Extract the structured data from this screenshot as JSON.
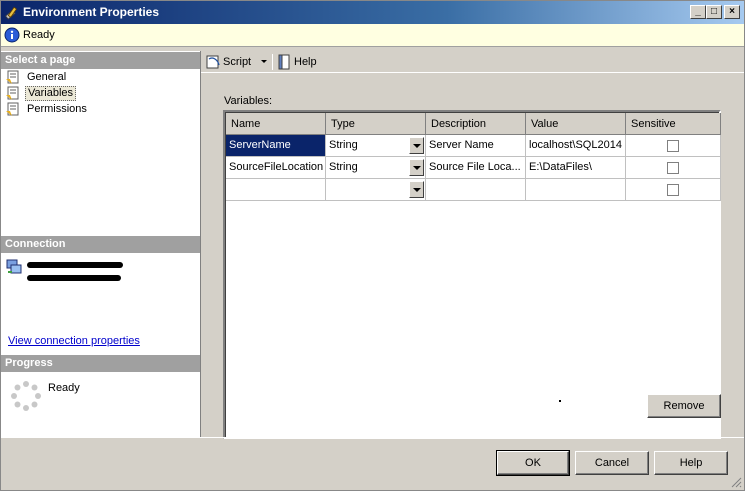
{
  "window": {
    "title": "Environment Properties",
    "icon": "tools-icon",
    "controls": {
      "minimize": "_",
      "maximize": "□",
      "close": "×"
    }
  },
  "status": {
    "text": "Ready",
    "icon": "info-icon"
  },
  "left_pane": {
    "select_page_header": "Select a page",
    "pages": [
      {
        "label": "General",
        "icon": "page-icon",
        "selected": false
      },
      {
        "label": "Variables",
        "icon": "page-icon",
        "selected": true
      },
      {
        "label": "Permissions",
        "icon": "page-icon",
        "selected": false
      }
    ],
    "connection_header": "Connection",
    "connection_link": "View connection properties",
    "progress_header": "Progress",
    "progress_text": "Ready"
  },
  "toolbar": {
    "script_label": "Script",
    "help_label": "Help"
  },
  "variables": {
    "label": "Variables:",
    "columns": [
      "Name",
      "Type",
      "Description",
      "Value",
      "Sensitive"
    ],
    "rows": [
      {
        "name": "ServerName",
        "type": "String",
        "description": "Server Name",
        "value": "localhost\\SQL2014",
        "sensitive": false
      },
      {
        "name": "SourceFileLocation",
        "type": "String",
        "description": "Source File Loca...",
        "value": "E:\\DataFiles\\",
        "sensitive": false
      },
      {
        "name": "",
        "type": "",
        "description": "",
        "value": "",
        "sensitive": false
      }
    ]
  },
  "buttons": {
    "remove": "Remove",
    "ok": "OK",
    "cancel": "Cancel",
    "help": "Help"
  },
  "colors": {
    "selection": "#0a246a",
    "header_gray": "#a0a0a0",
    "status_bg": "#ffffe1",
    "link": "#0000cc"
  }
}
